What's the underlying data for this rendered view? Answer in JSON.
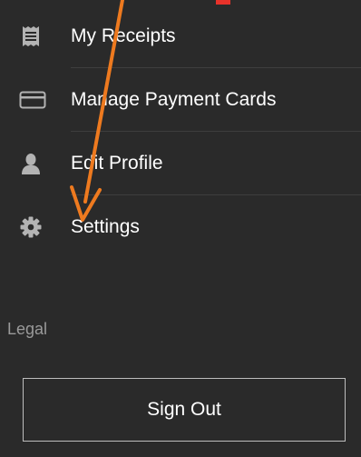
{
  "menu": {
    "items": [
      {
        "label": "My Receipts",
        "icon": "receipt-icon"
      },
      {
        "label": "Manage Payment Cards",
        "icon": "credit-card-icon"
      },
      {
        "label": "Edit Profile",
        "icon": "person-icon"
      },
      {
        "label": "Settings",
        "icon": "gear-icon"
      }
    ]
  },
  "legal": {
    "label": "Legal"
  },
  "signout": {
    "label": "Sign Out"
  },
  "annotation": {
    "arrow_color": "#ee7a1f",
    "marker_color": "#e8322a"
  },
  "colors": {
    "background": "#2a2a2a",
    "text": "#ffffff",
    "icon": "#b3b3b3",
    "legal_text": "#9a9a9a",
    "divider": "#3e3e3e",
    "button_border": "#bdbdbd"
  }
}
